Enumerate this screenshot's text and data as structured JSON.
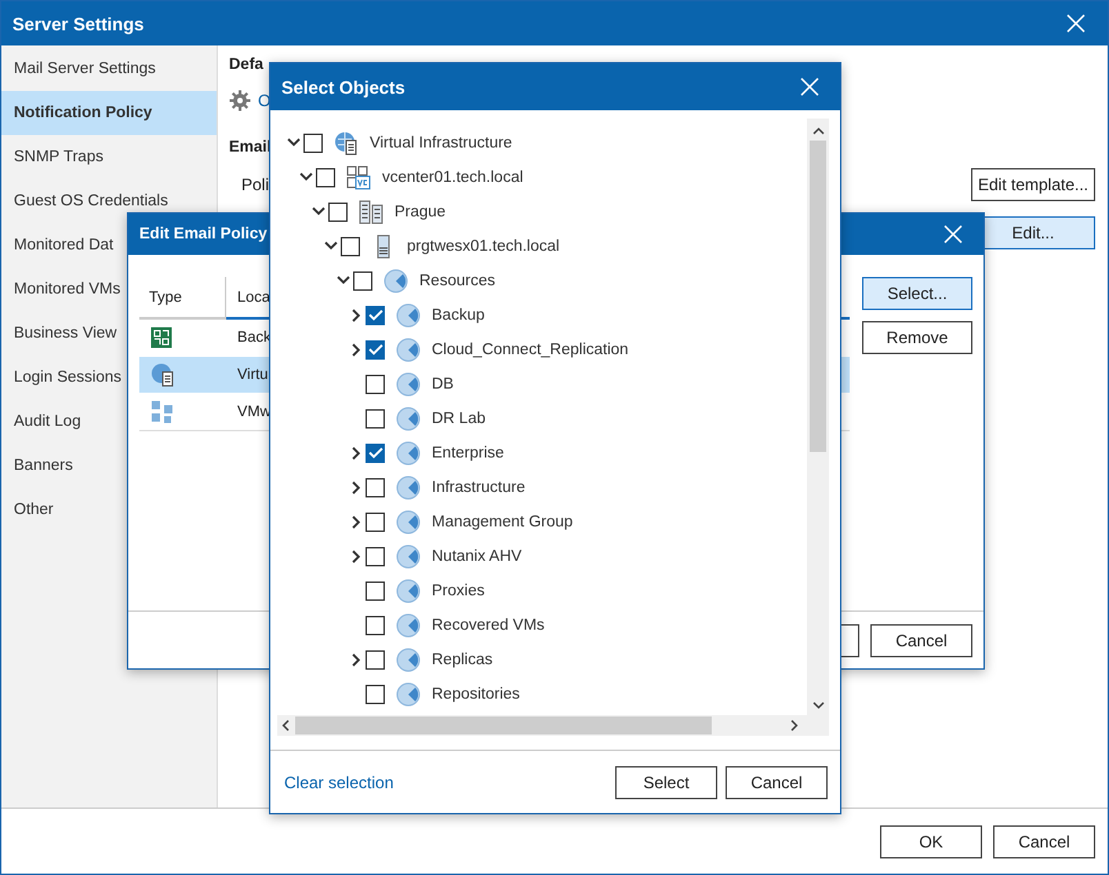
{
  "window": {
    "title": "Server Settings"
  },
  "sidebar": {
    "items": [
      {
        "label": "Mail Server Settings",
        "selected": false
      },
      {
        "label": "Notification Policy",
        "selected": true
      },
      {
        "label": "SNMP Traps",
        "selected": false
      },
      {
        "label": "Guest OS Credentials",
        "selected": false
      },
      {
        "label": "Monitored Dat",
        "selected": false
      },
      {
        "label": "Monitored VMs",
        "selected": false
      },
      {
        "label": "Business View",
        "selected": false
      },
      {
        "label": "Login Sessions",
        "selected": false
      },
      {
        "label": "Audit Log",
        "selected": false
      },
      {
        "label": "Banners",
        "selected": false
      },
      {
        "label": "Other",
        "selected": false
      }
    ]
  },
  "content": {
    "heading": "Defa",
    "link": "O",
    "email_heading": "Email",
    "policy_label": "Poli",
    "buttons": [
      {
        "label": "Edit template...",
        "selected": false
      },
      {
        "label": "Edit...",
        "selected": true
      }
    ]
  },
  "footer_buttons": [
    "OK",
    "Cancel"
  ],
  "edit_email_policy": {
    "title": "Edit Email Policy",
    "columns": [
      "Type",
      "Loca"
    ],
    "rows": [
      {
        "kind": "backup",
        "location": "Back",
        "selected": false
      },
      {
        "kind": "virtual",
        "location": "Virtu",
        "selected": true
      },
      {
        "kind": "vmware",
        "location": "VMw",
        "selected": false
      }
    ],
    "side_buttons": [
      {
        "label": "Select...",
        "selected": true
      },
      {
        "label": "Remove",
        "selected": false
      }
    ],
    "footer_buttons": [
      "Cancel"
    ]
  },
  "select_objects": {
    "title": "Select Objects",
    "tree": [
      {
        "label": "Virtual Infrastructure",
        "kind": "infrastructure",
        "has_children": true,
        "expanded": true,
        "checked": false,
        "children": [
          {
            "label": "vcenter01.tech.local",
            "kind": "vcenter",
            "has_children": true,
            "expanded": true,
            "checked": false,
            "children": [
              {
                "label": "Prague",
                "kind": "datacenter",
                "has_children": true,
                "expanded": true,
                "checked": false,
                "children": [
                  {
                    "label": "prgtwesx01.tech.local",
                    "kind": "host",
                    "has_children": true,
                    "expanded": true,
                    "checked": false,
                    "children": [
                      {
                        "label": "Resources",
                        "kind": "pool",
                        "has_children": true,
                        "expanded": true,
                        "checked": false,
                        "children": [
                          {
                            "label": "Backup",
                            "kind": "pool",
                            "has_children": true,
                            "expanded": false,
                            "checked": true
                          },
                          {
                            "label": "Cloud_Connect_Replication",
                            "kind": "pool",
                            "has_children": true,
                            "expanded": false,
                            "checked": true
                          },
                          {
                            "label": "DB",
                            "kind": "pool",
                            "has_children": false,
                            "checked": false
                          },
                          {
                            "label": "DR Lab",
                            "kind": "pool",
                            "has_children": false,
                            "checked": false
                          },
                          {
                            "label": "Enterprise",
                            "kind": "pool",
                            "has_children": true,
                            "expanded": false,
                            "checked": true
                          },
                          {
                            "label": "Infrastructure",
                            "kind": "pool",
                            "has_children": true,
                            "expanded": false,
                            "checked": false
                          },
                          {
                            "label": "Management Group",
                            "kind": "pool",
                            "has_children": true,
                            "expanded": false,
                            "checked": false
                          },
                          {
                            "label": "Nutanix AHV",
                            "kind": "pool",
                            "has_children": true,
                            "expanded": false,
                            "checked": false
                          },
                          {
                            "label": "Proxies",
                            "kind": "pool",
                            "has_children": false,
                            "checked": false
                          },
                          {
                            "label": "Recovered VMs",
                            "kind": "pool",
                            "has_children": false,
                            "checked": false
                          },
                          {
                            "label": "Replicas",
                            "kind": "pool",
                            "has_children": true,
                            "expanded": false,
                            "checked": false
                          },
                          {
                            "label": "Repositories",
                            "kind": "pool",
                            "has_children": false,
                            "checked": false
                          }
                        ]
                      }
                    ]
                  }
                ]
              }
            ]
          }
        ]
      }
    ],
    "clear_link": "Clear selection",
    "footer_buttons": [
      "Select",
      "Cancel"
    ]
  }
}
